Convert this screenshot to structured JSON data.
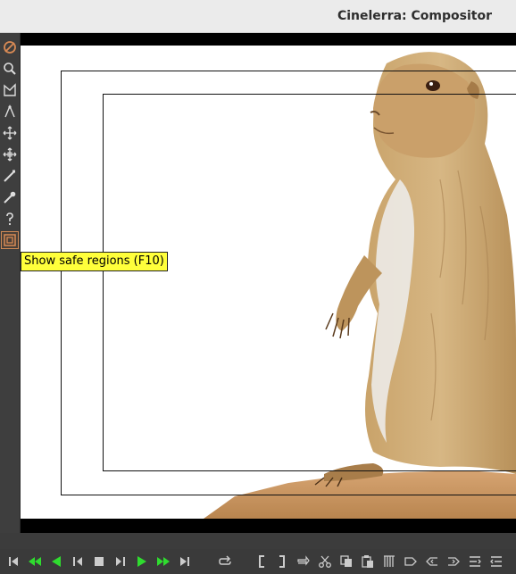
{
  "window": {
    "title": "Cinelerra: Compositor"
  },
  "toolbar": {
    "tools": [
      "protect-icon",
      "zoom-icon",
      "mask-icon",
      "ruler-icon",
      "camera-icon",
      "projector-icon",
      "crop-icon",
      "eyedropper-icon",
      "help-icon",
      "safe-regions-icon"
    ],
    "active_tool": "safe-regions-icon"
  },
  "tooltip": {
    "text": "Show safe regions (F10)"
  },
  "transport": {
    "buttons": [
      "rewind-to-start-icon",
      "fast-reverse-icon",
      "reverse-play-icon",
      "frame-back-icon",
      "stop-icon",
      "frame-forward-icon",
      "play-icon",
      "fast-forward-icon",
      "go-to-end-icon",
      "loop-icon",
      "in-point-icon",
      "out-point-icon",
      "splice-icon",
      "cut-icon",
      "copy-icon",
      "paste-icon",
      "overwrite-icon",
      "label-icon",
      "prev-label-icon",
      "next-label-icon",
      "fit-icon"
    ],
    "accent_color": "#2fdc2f"
  }
}
